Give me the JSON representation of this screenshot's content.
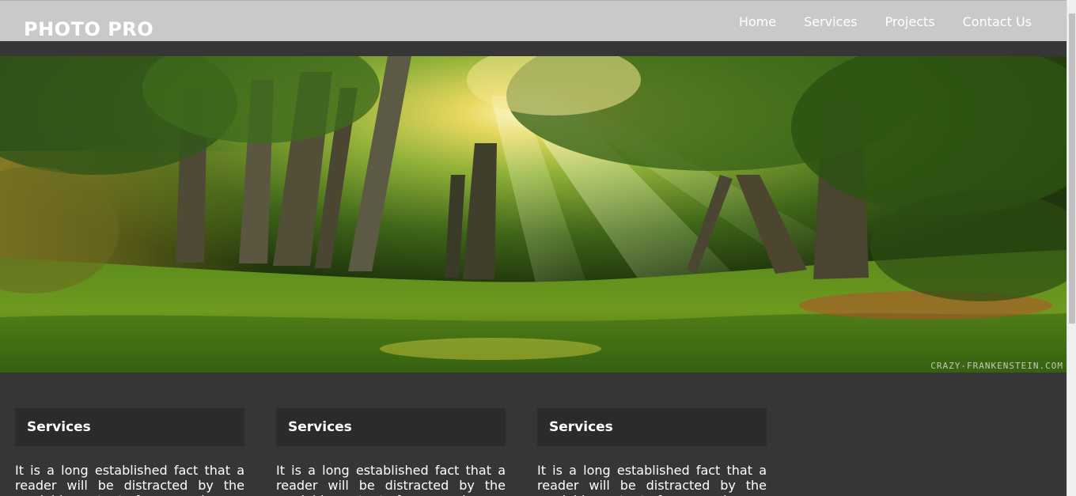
{
  "header": {
    "logo": "PHOTO PRO",
    "nav": [
      "Home",
      "Services",
      "Projects",
      "Contact Us"
    ]
  },
  "hero": {
    "watermark": "CRAZY-FRANKENSTEIN.COM",
    "icon": "forest-photo"
  },
  "cards": [
    {
      "title": "Services",
      "text": "It is a long established fact that a reader will be distracted by the readable content of a page when"
    },
    {
      "title": "Services",
      "text": "It is a long established fact that a reader will be distracted by the readable content of a page when"
    },
    {
      "title": "Services",
      "text": "It is a long established fact that a reader will be distracted by the readable content of a page when"
    }
  ],
  "colors": {
    "page_bg": "#363636",
    "header_bg": "#c9c9c9",
    "card_title_bg": "#2b2b2b",
    "text": "#ffffff"
  }
}
